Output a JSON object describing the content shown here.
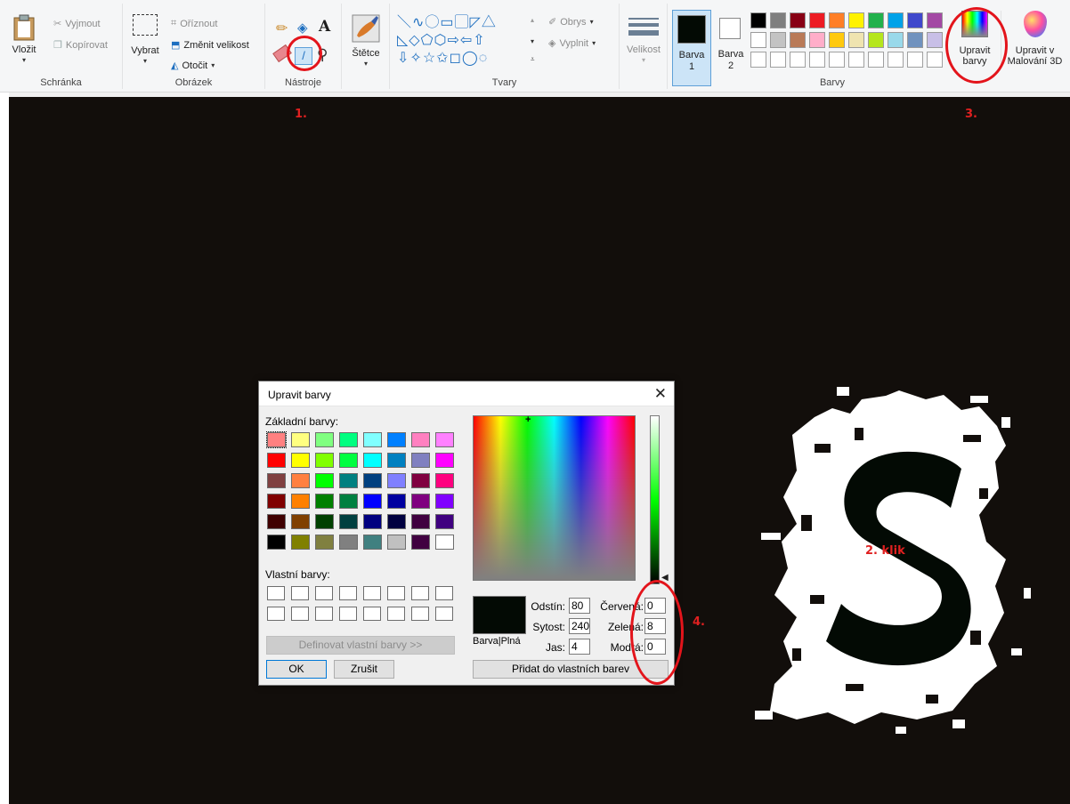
{
  "ribbon": {
    "clipboard": {
      "paste": "Vložit",
      "cut": "Vyjmout",
      "copy": "Kopírovat",
      "group": "Schránka"
    },
    "image": {
      "select": "Vybrat",
      "crop": "Oříznout",
      "resize": "Změnit velikost",
      "rotate": "Otočit",
      "group": "Obrázek"
    },
    "tools": {
      "group": "Nástroje"
    },
    "brushes": {
      "label": "Štětce"
    },
    "shapes": {
      "outline": "Obrys",
      "fill": "Vyplnit",
      "group": "Tvary"
    },
    "size": {
      "label": "Velikost"
    },
    "color1": {
      "line1": "Barva",
      "line2": "1"
    },
    "color2": {
      "line1": "Barva",
      "line2": "2"
    },
    "colors": {
      "group": "Barvy",
      "edit_line1": "Upravit",
      "edit_line2": "barvy"
    },
    "paint3d": {
      "line1": "Upravit v",
      "line2": "Malování 3D"
    }
  },
  "palette": {
    "row1": [
      "#000000",
      "#7f7f7f",
      "#880015",
      "#ed1c24",
      "#ff7f27",
      "#fff200",
      "#22b14c",
      "#00a2e8",
      "#3f48cc",
      "#a349a4"
    ],
    "row2": [
      "#ffffff",
      "#c3c3c3",
      "#b97a57",
      "#ffaec9",
      "#ffc90e",
      "#efe4b0",
      "#b5e61d",
      "#99d9ea",
      "#7092be",
      "#c8bfe7"
    ],
    "color1_value": "#030a04",
    "color2_value": "#ffffff"
  },
  "annotations": {
    "step1": "1.",
    "step2": "2. klik",
    "step3": "3.",
    "step4": "4."
  },
  "dialog": {
    "title": "Upravit barvy",
    "basic_label": "Základní barvy:",
    "custom_label": "Vlastní barvy:",
    "define_button": "Definovat vlastní barvy >>",
    "ok_button": "OK",
    "cancel_button": "Zrušit",
    "color_solid_label": "Barva|Plná",
    "hue_label": "Odstín:",
    "hue": "80",
    "sat_label": "Sytost:",
    "sat": "240",
    "lum_label": "Jas:",
    "lum": "4",
    "red_label": "Červená:",
    "red": "0",
    "green_label": "Zelená:",
    "green": "8",
    "blue_label": "Modrá:",
    "blue": "0",
    "add_custom_button": "Přidat do vlastních barev",
    "preview_color": "#030a04",
    "basic_colors": [
      [
        "#ff8080",
        "#ffff80",
        "#80ff80",
        "#00ff80",
        "#80ffff",
        "#0080ff",
        "#ff80c0",
        "#ff80ff"
      ],
      [
        "#ff0000",
        "#ffff00",
        "#80ff00",
        "#00ff40",
        "#00ffff",
        "#0080c0",
        "#8080c0",
        "#ff00ff"
      ],
      [
        "#804040",
        "#ff8040",
        "#00ff00",
        "#008080",
        "#004080",
        "#8080ff",
        "#800040",
        "#ff0080"
      ],
      [
        "#800000",
        "#ff8000",
        "#008000",
        "#008040",
        "#0000ff",
        "#0000a0",
        "#800080",
        "#8000ff"
      ],
      [
        "#400000",
        "#804000",
        "#004000",
        "#004040",
        "#000080",
        "#000040",
        "#400040",
        "#400080"
      ],
      [
        "#000000",
        "#808000",
        "#808040",
        "#808080",
        "#408080",
        "#c0c0c0",
        "#400040",
        "#ffffff"
      ]
    ]
  }
}
